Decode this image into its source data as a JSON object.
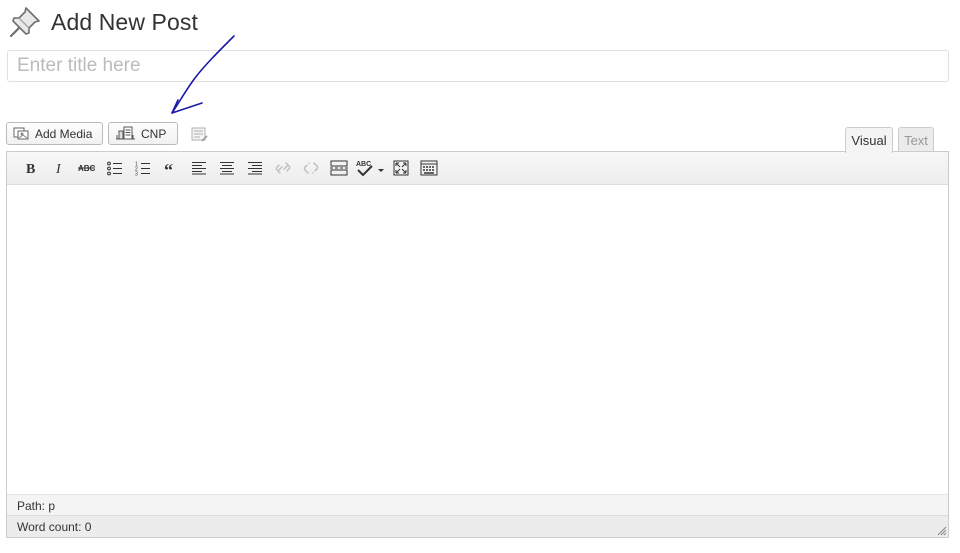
{
  "page": {
    "title": "Add New Post"
  },
  "title_field": {
    "value": "",
    "placeholder": "Enter title here"
  },
  "media_buttons": {
    "add_media_label": "Add Media",
    "cnp_label": "CNP"
  },
  "editor_tabs": {
    "visual_label": "Visual",
    "text_label": "Text",
    "active": "Visual"
  },
  "toolbar": {
    "buttons": [
      {
        "name": "bold",
        "icon": "bold-icon"
      },
      {
        "name": "italic",
        "icon": "italic-icon"
      },
      {
        "name": "strikethrough",
        "icon": "strikethrough-icon"
      },
      {
        "name": "bulleted-list",
        "icon": "bulleted-list-icon"
      },
      {
        "name": "numbered-list",
        "icon": "numbered-list-icon"
      },
      {
        "name": "blockquote",
        "icon": "blockquote-icon"
      },
      {
        "name": "align-left",
        "icon": "align-left-icon"
      },
      {
        "name": "align-center",
        "icon": "align-center-icon"
      },
      {
        "name": "align-right",
        "icon": "align-right-icon"
      },
      {
        "name": "insert-link",
        "icon": "link-icon"
      },
      {
        "name": "remove-link",
        "icon": "unlink-icon"
      },
      {
        "name": "insert-more",
        "icon": "more-tag-icon"
      },
      {
        "name": "spellcheck",
        "icon": "spellcheck-icon"
      },
      {
        "name": "fullscreen",
        "icon": "fullscreen-icon"
      },
      {
        "name": "kitchen-sink",
        "icon": "kitchen-sink-icon"
      }
    ]
  },
  "status": {
    "path": "Path: p",
    "word_count": "Word count: 0"
  },
  "colors": {
    "annotation_arrow": "#1a1aa8",
    "placeholder_text": "#bbbbbb",
    "border": "#cccccc"
  }
}
